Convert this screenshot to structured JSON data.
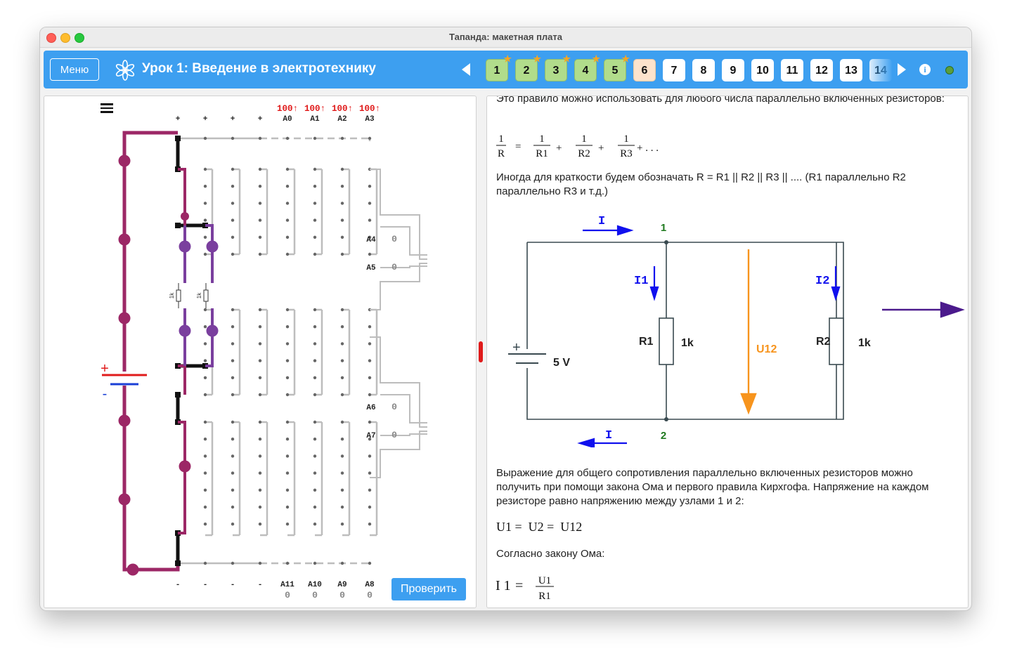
{
  "window": {
    "title": "Тапанда: макетная плата"
  },
  "toolbar": {
    "menu_label": "Меню",
    "lesson_title": "Урок 1: Введение в электротехнику",
    "steps": [
      {
        "label": "1",
        "state": "done",
        "starred": true
      },
      {
        "label": "2",
        "state": "done",
        "starred": true
      },
      {
        "label": "3",
        "state": "done",
        "starred": true
      },
      {
        "label": "4",
        "state": "done",
        "starred": true
      },
      {
        "label": "5",
        "state": "done",
        "starred": true
      },
      {
        "label": "6",
        "state": "current",
        "starred": false
      },
      {
        "label": "7",
        "state": "todo",
        "starred": false
      },
      {
        "label": "8",
        "state": "todo",
        "starred": false
      },
      {
        "label": "9",
        "state": "todo",
        "starred": false
      },
      {
        "label": "10",
        "state": "todo",
        "starred": false
      },
      {
        "label": "11",
        "state": "todo",
        "starred": false
      },
      {
        "label": "12",
        "state": "todo",
        "starred": false
      },
      {
        "label": "13",
        "state": "todo",
        "starred": false
      },
      {
        "label": "14",
        "state": "todo",
        "starred": false
      }
    ],
    "colors": {
      "bar": "#3d9ff0",
      "done": "#b1dc8b",
      "current": "#fde3cc",
      "status": "#5b9e3c"
    }
  },
  "breadboard": {
    "top_power_labels": [
      "+",
      "+",
      "+",
      "+"
    ],
    "top_channels": [
      {
        "name": "A0",
        "value": "100↑"
      },
      {
        "name": "A1",
        "value": "100↑"
      },
      {
        "name": "A2",
        "value": "100↑"
      },
      {
        "name": "A3",
        "value": "100↑"
      }
    ],
    "side_channels": [
      {
        "name": "A4",
        "value": "0"
      },
      {
        "name": "A5",
        "value": "0"
      },
      {
        "name": "A6",
        "value": "0"
      },
      {
        "name": "A7",
        "value": "0"
      }
    ],
    "bottom_power_labels": [
      "-",
      "-",
      "-",
      "-"
    ],
    "bottom_channels": [
      {
        "name": "A11",
        "value": "0"
      },
      {
        "name": "A10",
        "value": "0"
      },
      {
        "name": "A9",
        "value": "0"
      },
      {
        "name": "A8",
        "value": "0"
      }
    ],
    "battery_plus": "+",
    "battery_minus": "-",
    "resistor_labels": [
      "1k",
      "1k"
    ],
    "check_label": "Проверить"
  },
  "lesson": {
    "p1": "Это правило можно использовать для любого числа параллельно включенных резисторов:",
    "formula1": {
      "lhs_num": "1",
      "lhs_den": "R",
      "eq": "=",
      "terms": [
        {
          "num": "1",
          "den": "R1"
        },
        {
          "num": "1",
          "den": "R2"
        },
        {
          "num": "1",
          "den": "R3"
        }
      ],
      "plus": "+",
      "tail": "+ . . ."
    },
    "p2": "Иногда для краткости будем обозначать R = R1 || R2 || R3 || .... (R1 параллельно R2 параллельно R3 и т.д.)",
    "circuit": {
      "current": "I",
      "current_return": "I",
      "node1": "1",
      "node2": "2",
      "i1": "I1",
      "i2": "I2",
      "r1": "R1",
      "r1_value": "1k",
      "r2": "R2",
      "r2_value": "1k",
      "u12": "U12",
      "battery_plus": "+",
      "battery_voltage": "5 V",
      "colors": {
        "current": "#1010ee",
        "node": "#1f7a1f",
        "voltage": "#f7941d",
        "nav_arrow": "#4b1a8c"
      }
    },
    "p3": "Выражение для общего сопротивления параллельно включенных резисторов можно получить при помощи закона Ома и первого правила Кирхгофа. Напряжение на каждом резисторе равно напряжению между узлами 1 и 2:",
    "formula2": "U1 =  U2 =  U12",
    "p4": "Согласно закону Ома:",
    "formula3": {
      "lhs": "I 1",
      "eq": "=",
      "num": "U1",
      "den": "R1"
    }
  }
}
